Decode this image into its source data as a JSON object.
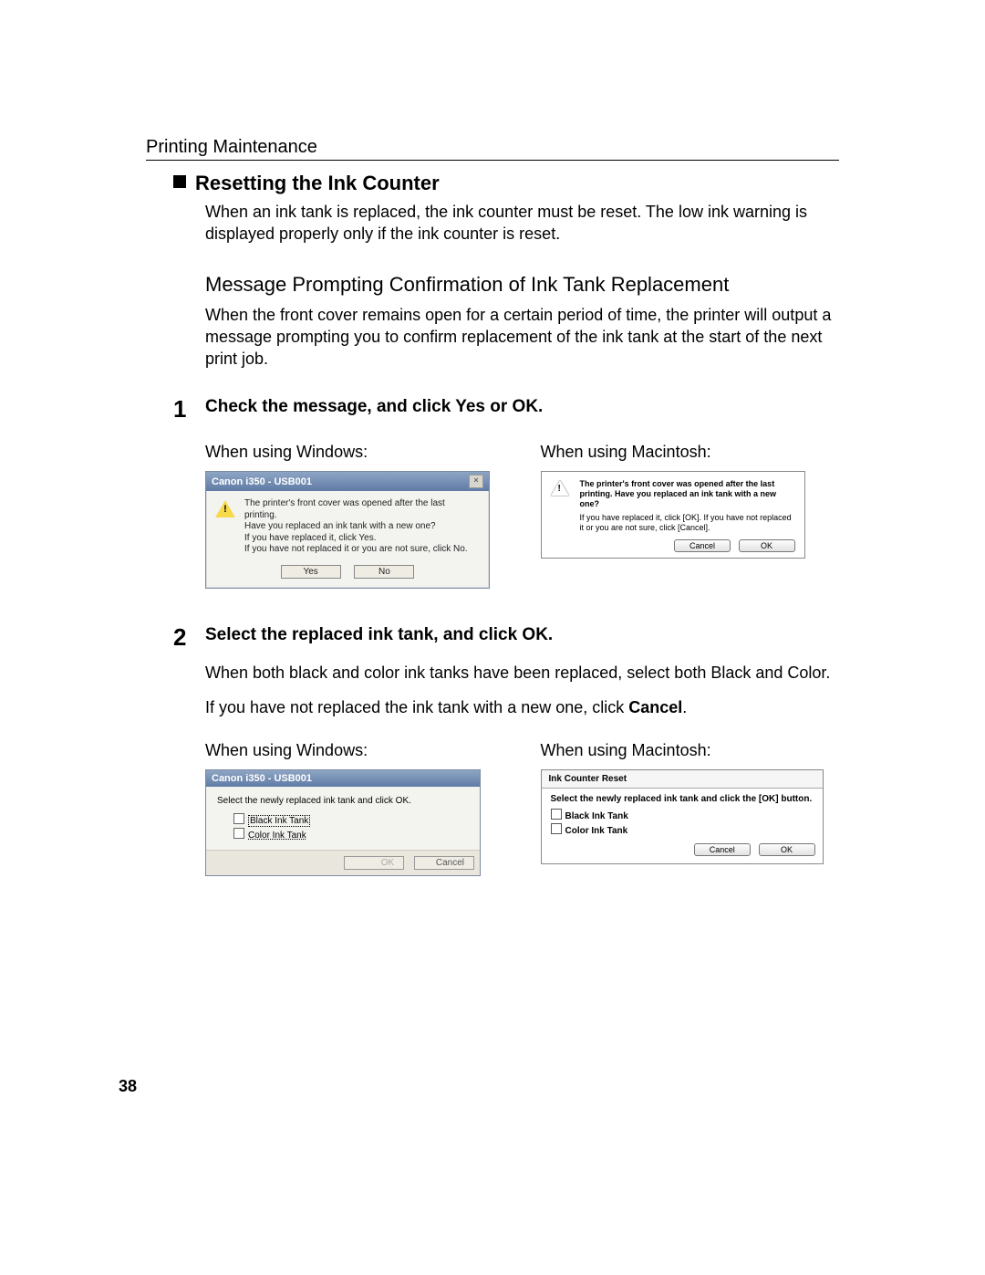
{
  "header": "Printing Maintenance",
  "section_title": "Resetting the Ink Counter",
  "intro": "When an ink tank is replaced, the ink counter must be reset. The low ink warning is displayed properly only if the ink counter is reset.",
  "message_heading": "Message Prompting Confirmation of Ink Tank Replacement",
  "message_para": "When the front cover remains open for a certain period of time, the printer will output a message prompting you to confirm replacement of the ink tank at the start of the next print job.",
  "steps": {
    "s1": {
      "num": "1",
      "title": "Check the message, and click Yes or OK.",
      "win_label": "When using Windows:",
      "mac_label": "When using Macintosh:",
      "win_dialog": {
        "title": "Canon i350 - USB001",
        "msg_l1": "The printer's front cover was opened after the last printing.",
        "msg_l2": "Have you replaced an ink tank with a new one?",
        "msg_l3": "If you have replaced it, click Yes.",
        "msg_l4": "If you have not replaced it or you are not sure, click No.",
        "btn_yes": "Yes",
        "btn_no": "No"
      },
      "mac_dialog": {
        "bold": "The printer's front cover was opened after the last printing. Have you replaced an ink tank with a new one?",
        "reg": "If you have replaced it, click [OK]. If you have not replaced it or you are not sure, click [Cancel].",
        "btn_cancel": "Cancel",
        "btn_ok": "OK"
      }
    },
    "s2": {
      "num": "2",
      "title": "Select the replaced ink tank, and click OK.",
      "para1": "When both black and color ink tanks have been replaced, select both Black and Color.",
      "para2_pre": "If you have not replaced the ink tank with a new one, click ",
      "para2_bold": "Cancel",
      "para2_post": ".",
      "win_label": "When using Windows:",
      "mac_label": "When using Macintosh:",
      "win_dialog": {
        "title": "Canon i350 - USB001",
        "instr": "Select the newly replaced ink tank and click OK.",
        "chk_black": "Black Ink Tank",
        "chk_color": "Color Ink Tank",
        "btn_ok": "OK",
        "btn_cancel": "Cancel"
      },
      "mac_dialog": {
        "title": "Ink Counter Reset",
        "instr": "Select the newly replaced ink tank and click the [OK] button.",
        "chk_black": "Black Ink Tank",
        "chk_color": "Color Ink Tank",
        "btn_cancel": "Cancel",
        "btn_ok": "OK"
      }
    }
  },
  "page_number": "38"
}
